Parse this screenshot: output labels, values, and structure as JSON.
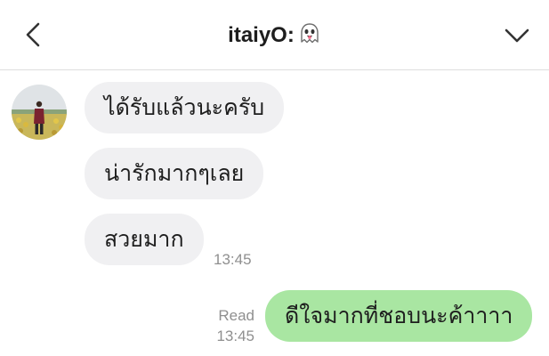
{
  "header": {
    "title": "itaiyO:",
    "title_emoji": "ghost-icon",
    "back_icon": "chevron-left-icon",
    "menu_icon": "chevron-down-icon"
  },
  "messages": [
    {
      "direction": "in",
      "text": "ได้รับแล้วนะครับ"
    },
    {
      "direction": "in",
      "text": "น่ารักมากๆเลย"
    },
    {
      "direction": "in",
      "text": "สวยมาก",
      "time": "13:45"
    },
    {
      "direction": "out",
      "text": "ดีใจมากที่ชอบนะค้าาาา",
      "read": "Read",
      "time": "13:45"
    }
  ],
  "colors": {
    "incoming_bubble": "#f0f0f2",
    "outgoing_bubble": "#a9e6a2",
    "meta_text": "#8f8f8f"
  }
}
